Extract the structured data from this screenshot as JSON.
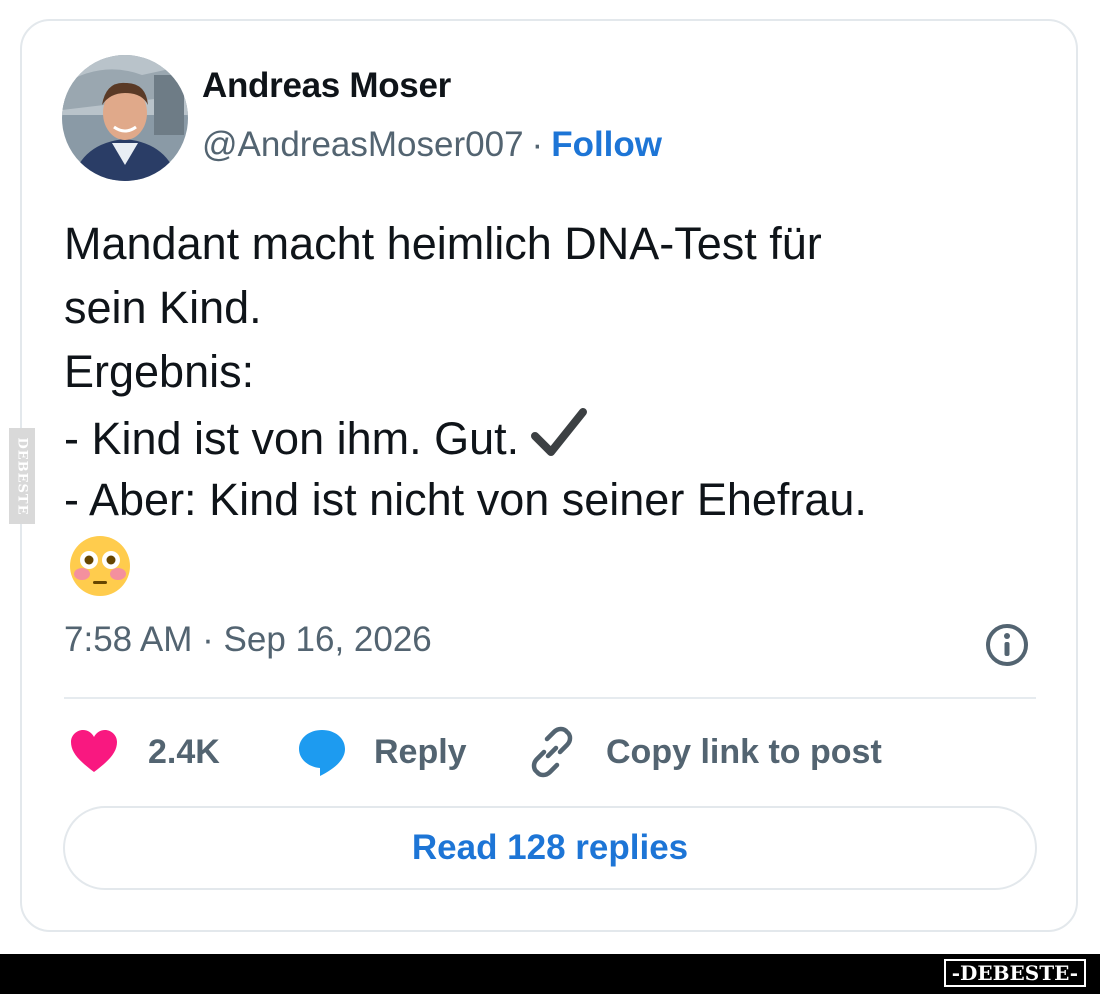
{
  "author": {
    "name": "Andreas Moser",
    "handle": "@AndreasMoser007",
    "separator": "·",
    "follow_label": "Follow"
  },
  "tweet": {
    "lines": [
      "Mandant macht heimlich DNA-Test für",
      "sein Kind.",
      "Ergebnis:",
      "- Kind ist von ihm. Gut.",
      "- Aber: Kind ist nicht von seiner Ehefrau."
    ],
    "inline_icon": "check-mark-icon",
    "trailing_emoji": "flushed-face-emoji"
  },
  "meta": {
    "timestamp": "7:58 AM · Sep 16, 2026",
    "info_icon": "info-icon"
  },
  "actions": {
    "likes": {
      "icon": "heart-icon",
      "count": "2.4K",
      "color": "#f91880"
    },
    "reply": {
      "icon": "speech-bubble-icon",
      "label": "Reply",
      "color": "#1d9bf0"
    },
    "copy_link": {
      "icon": "link-icon",
      "label": "Copy link to post"
    }
  },
  "read_replies": {
    "label": "Read 128 replies"
  },
  "watermark": {
    "side_text": "DEBESTE",
    "footer_text": "-DEBESTE-"
  },
  "colors": {
    "link_blue": "#1d75d6",
    "secondary_text": "#536471",
    "border": "#e3e8ec"
  }
}
